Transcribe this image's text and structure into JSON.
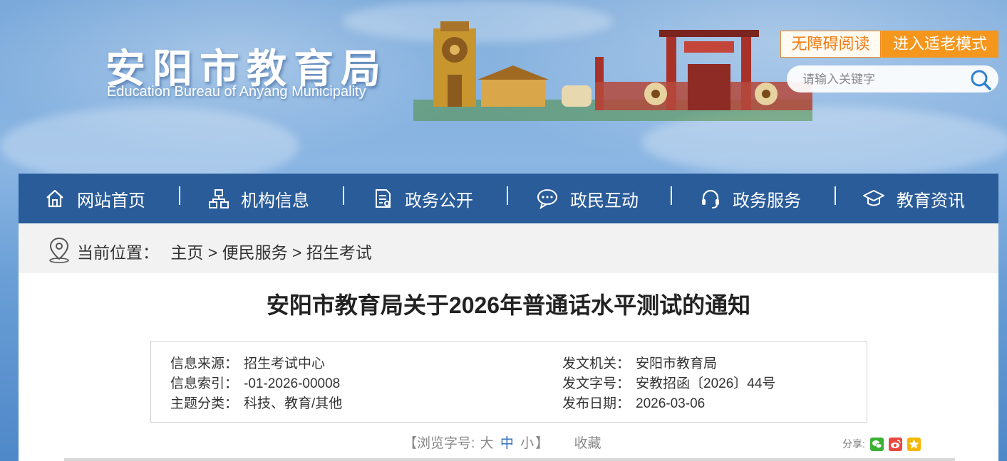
{
  "header": {
    "logo_cn": "安阳市教育局",
    "logo_en": "Education Bureau  of Anyang Municipality",
    "accessibility_button": "无障碍阅读",
    "elder_mode_button": "进入适老模式",
    "search": {
      "placeholder": "请输入关键字",
      "icon": "search-icon"
    }
  },
  "nav": {
    "items": [
      {
        "label": "网站首页",
        "icon": "home-icon"
      },
      {
        "label": "机构信息",
        "icon": "org-chart-icon"
      },
      {
        "label": "政务公开",
        "icon": "document-icon"
      },
      {
        "label": "政民互动",
        "icon": "chat-icon"
      },
      {
        "label": "政务服务",
        "icon": "headset-icon"
      },
      {
        "label": "教育资讯",
        "icon": "graduation-cap-icon"
      }
    ]
  },
  "breadcrumb": {
    "prefix": "当前位置：",
    "home": "主页",
    "sep": " > ",
    "level1": "便民服务",
    "level2": "招生考试"
  },
  "article": {
    "title": "安阳市教育局关于2026年普通话水平测试的通知",
    "meta": {
      "source_label": "信息来源：",
      "source_value": "招生考试中心",
      "index_label": "信息索引：",
      "index_value": "-01-2026-00008",
      "category_label": "主题分类：",
      "category_value": "科技、教育/其他",
      "issuer_label": "发文机关：",
      "issuer_value": "安阳市教育局",
      "docno_label": "发文字号：",
      "docno_value": "安教招函〔2026〕44号",
      "date_label": "发布日期：",
      "date_value": "2026-03-06"
    },
    "font_size": {
      "prefix": "【浏览字号:",
      "large": "大",
      "medium": "中",
      "small": "小",
      "suffix": "】",
      "active": "medium"
    },
    "favorite": "收藏",
    "share_label": "分享:",
    "share_icons": [
      "wechat-icon",
      "weibo-icon",
      "qzone-icon"
    ]
  },
  "colors": {
    "nav_bg": "#2a5c9a",
    "accent_orange": "#f5961d",
    "crumb_bg": "#f2f2f2"
  }
}
